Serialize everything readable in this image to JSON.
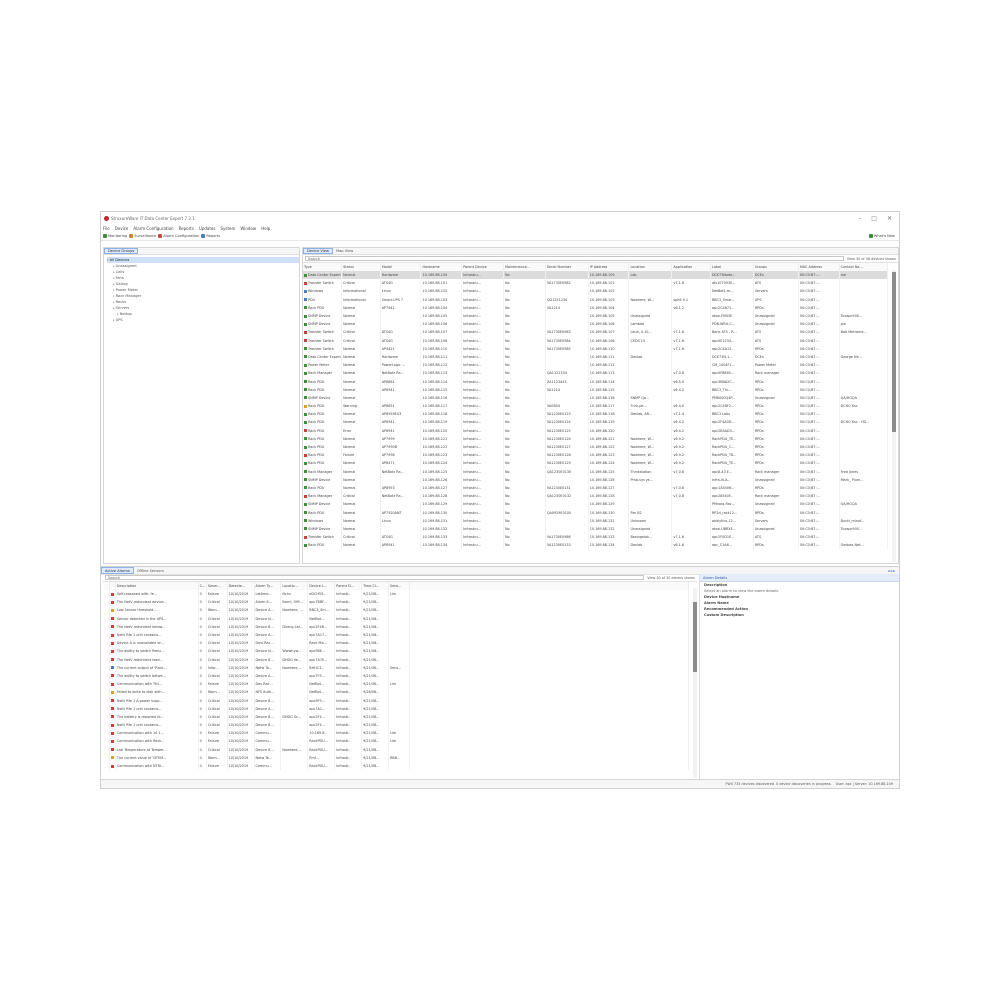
{
  "window": {
    "title": "StruxureWare IT Data Center Expert 7.3.1",
    "minimize": "–",
    "maximize": "□",
    "close": "✕"
  },
  "menu": [
    "File",
    "Device",
    "Alarm Configuration",
    "Reports",
    "Updates",
    "System",
    "Window",
    "Help"
  ],
  "toolbar": {
    "items": [
      {
        "label": "Monitoring",
        "color": "#3a8e3a"
      },
      {
        "label": "Surveillance",
        "color": "#c98a28"
      },
      {
        "label": "Alarm Configuration",
        "color": "#c44"
      },
      {
        "label": "Reports",
        "color": "#4a7cc0"
      }
    ],
    "right_label": "What's New"
  },
  "left_pane": {
    "tab": "Device Groups",
    "tree": [
      {
        "label": "All Devices",
        "level": 0,
        "selected": true
      },
      {
        "label": "Unassigned",
        "level": 1
      },
      {
        "label": "Cells",
        "level": 1
      },
      {
        "label": "Fans",
        "level": 1
      },
      {
        "label": "Galaxy",
        "level": 1
      },
      {
        "label": "Power Meter",
        "level": 1
      },
      {
        "label": "Rack Manager",
        "level": 1
      },
      {
        "label": "Racks",
        "level": 1
      },
      {
        "label": "Servers",
        "level": 1
      },
      {
        "label": "Nettop",
        "level": 2
      },
      {
        "label": "UPS",
        "level": 1
      }
    ]
  },
  "device_view": {
    "tabs": [
      "Device View",
      "Map View"
    ],
    "search_placeholder": "Search",
    "view_info": "View 30 of 36 devices shown",
    "columns": [
      "Type",
      "Status",
      "Model",
      "Hostname",
      "Parent Device",
      "Maintenance...",
      "Serial Number",
      "IP Address",
      "Location",
      "Application",
      "Label",
      "Groups",
      "MAC Address",
      "Contact Na..."
    ],
    "rows": [
      [
        "Data Center Expert",
        "Normal",
        "Hardware",
        "10.169.88.109",
        "Infrastru...",
        "No",
        "",
        "10.169.88.109",
        "Lab",
        "",
        "DCE73Node...",
        "DCEs",
        "00:C0:B7:...",
        "me"
      ],
      [
        "Transfer Switch",
        "Critical",
        "ATS4G",
        "10.169.88.101",
        "Infrastru...",
        "No",
        "5A1730E0982",
        "10.169.88.101",
        "",
        "v7.1.6",
        "ats1070930...",
        "ATS",
        "00:C0:B7:...",
        ""
      ],
      [
        "Windows",
        "Informational",
        "Linux",
        "10.169.88.102",
        "Infrastru...",
        "No",
        "",
        "10.169.88.102",
        "",
        "",
        "NetBot1.m...",
        "Servers",
        "00:C0:B7:...",
        ""
      ],
      [
        "PDU",
        "Informational",
        "Smart-UPS 7",
        "10.169.88.103",
        "Infrastru...",
        "No",
        "QD1251234",
        "10.169.88.103",
        "Nowhere, W...",
        "sph6.9.1",
        "BBC3_Smar...",
        "UPS",
        "00:C0:B7:...",
        ""
      ],
      [
        "Rack PDU",
        "Normal",
        "AP7941",
        "10.169.88.104",
        "Infrastru...",
        "No",
        "5A1214",
        "10.169.88.104",
        "",
        "v6.1.2",
        "apc2C4671...",
        "RPDs",
        "00:C0:B7:...",
        ""
      ],
      [
        "SNMP Device",
        "Normal",
        "",
        "10.169.88.105",
        "Infrastru...",
        "No",
        "",
        "10.169.88.105",
        "Unassigned",
        "",
        "atsw-FM05E",
        "Unassigned",
        "00:C0:B7:...",
        "Tuxapc900..."
      ],
      [
        "SNMP Device",
        "Normal",
        "",
        "10.169.88.106",
        "Infrastru...",
        "No",
        "",
        "10.169.88.106",
        "Lambda",
        "",
        "PDB-WRU-C...",
        "Unassigned",
        "00:C0:B7:...",
        "joe"
      ],
      [
        "Transfer Switch",
        "Critical",
        "ATS4G",
        "10.169.88.107",
        "Infrastru...",
        "No",
        "5A1730E0983",
        "10.169.88.107",
        "Laub, 0.10...",
        "v7.1.6",
        "Bank ATS - R...",
        "ATS",
        "00:C0:B7:...",
        "Bob Metrame..."
      ],
      [
        "Transfer Switch",
        "Critical",
        "ATS4G",
        "10.169.88.108",
        "Infrastru...",
        "No",
        "5A1730E0984",
        "10.169.88.108",
        "CEDS 15",
        "v7.1.6",
        "apc0E1234...",
        "ATS",
        "00:C0:B7:...",
        ""
      ],
      [
        "Transfer Switch",
        "Normal",
        "AP4421",
        "10.169.88.110",
        "Infrastru...",
        "No",
        "5A1730E0985",
        "10.169.88.110",
        "",
        "v7.1.6",
        "apc2C4A12...",
        "RPDs",
        "00:C0:B7:...",
        ""
      ],
      [
        "Data Center Expert",
        "Normal",
        "Hardware",
        "10.169.88.111",
        "Infrastru...",
        "No",
        "",
        "10.169.88.111",
        "Devlab",
        "",
        "DCE73N-1...",
        "DCEs",
        "00:C0:B7:...",
        "George Ne..."
      ],
      [
        "Power Meter",
        "Normal",
        "PowerLogic ...",
        "10.169.88.112",
        "Infrastru...",
        "No",
        "",
        "10.169.88.112",
        "",
        "",
        "CM_1004F1...",
        "Power Meter",
        "00:C0:B7:...",
        ""
      ],
      [
        "Rack Manager",
        "Normal",
        "NetBotz Ra...",
        "10.169.88.113",
        "Infrastru...",
        "No",
        "QA1122334",
        "10.169.88.113",
        "",
        "v7.0.8",
        "apc0F8880...",
        "Rack manager",
        "00:C0:B7:...",
        ""
      ],
      [
        "Rack PDU",
        "Normal",
        "AP8861",
        "10.169.88.114",
        "Infrastru...",
        "No",
        "ZA1123443",
        "10.169.88.114",
        "",
        "v6.5.0",
        "apc3BBA2C...",
        "RPDs",
        "00:C0:B7:...",
        ""
      ],
      [
        "Rack PDU",
        "Normal",
        "AP8941",
        "10.169.88.115",
        "Infrastru...",
        "No",
        "5A1214",
        "10.169.88.115",
        "",
        "v6.4.2",
        "BBC3_Thi-...",
        "RPDs",
        "00:C0:B7:...",
        ""
      ],
      [
        "SNMP Device",
        "Normal",
        "",
        "10.169.88.116",
        "Infrastru...",
        "No",
        "",
        "10.169.88.116",
        "SNMP Qa...",
        "",
        "PM8000Q4P...",
        "Unassigned",
        "00:C0:B7:...",
        "QA/HGQA"
      ],
      [
        "Rack PDU",
        "Warning",
        "AP8651",
        "10.169.88.117",
        "Infrastru...",
        "No",
        "5A0804",
        "10.169.88.117",
        "Tnrk-pe...",
        "v6.4.0",
        "apc2C48F2...",
        "RPDs",
        "00:C0:B7:...",
        "DCHG Ksc"
      ],
      [
        "Rack PDU",
        "Normal",
        "AP8959EU3",
        "10.169.88.118",
        "Infrastru...",
        "No",
        "5A1230E0123",
        "10.169.88.118",
        "Devlab, AR...",
        "v7.1.4",
        "BBC3 Labs",
        "RPDs",
        "00:C0:B7:...",
        ""
      ],
      [
        "Rack PDU",
        "Normal",
        "AP8941",
        "10.169.88.119",
        "Infrastru...",
        "No",
        "5A1230E0124",
        "10.169.88.119",
        "",
        "v6.4.2",
        "apc2F4A0D...",
        "RPDs",
        "00:C0:B7:...",
        "DCHG Ksc - HG..."
      ],
      [
        "Rack PDU",
        "Error",
        "AP8941",
        "10.169.88.120",
        "Infrastru...",
        "No",
        "5A1230E0125",
        "10.169.88.120",
        "",
        "v6.4.2",
        "apc2B3AD3...",
        "RPDs",
        "00:C0:B7:...",
        ""
      ],
      [
        "Rack PDU",
        "Normal",
        "AP7999",
        "10.169.88.121",
        "Infrastru...",
        "No",
        "5A1230E0126",
        "10.169.88.121",
        "Nowhere, W...",
        "v6.9.2",
        "RackPDU_TE...",
        "RPDs",
        "00:C0:B7:...",
        ""
      ],
      [
        "Rack PDU",
        "Normal",
        "AP7990B",
        "10.169.88.122",
        "Infrastru...",
        "No",
        "5A1230E0127",
        "10.169.88.122",
        "Nowhere, W...",
        "v6.9.2",
        "RackPDU_C...",
        "RPDs",
        "00:C0:B7:...",
        ""
      ],
      [
        "Rack PDU",
        "Failure",
        "AP7998",
        "10.169.88.123",
        "Infrastru...",
        "No",
        "5A1230E0128",
        "10.169.88.123",
        "Nowhere, W...",
        "v6.9.2",
        "RackPDU_T8...",
        "RPDs",
        "00:C0:B7:...",
        ""
      ],
      [
        "Rack PDU",
        "Normal",
        "AP8471",
        "10.169.88.124",
        "Infrastru...",
        "No",
        "5A1230E0129",
        "10.169.88.124",
        "Nowhere, W...",
        "v6.9.2",
        "RackPDU_TE...",
        "RPDs",
        "00:C0:B7:...",
        ""
      ],
      [
        "Rack Manager",
        "Normal",
        "NetBotz Ra...",
        "10.169.88.125",
        "Infrastru...",
        "No",
        "QA1230E0130",
        "10.169.88.125",
        "Thinkstation",
        "v7.0.8",
        "apc8-43 E...",
        "Rack manager",
        "00:C0:B7:...",
        "Fred Jones"
      ],
      [
        "SNMP Device",
        "Normal",
        "",
        "10.169.88.126",
        "Infrastru...",
        "No",
        "",
        "10.169.88.126",
        "Pmb-sys ys...",
        "",
        "Infra-VLA...",
        "Unassigned",
        "00:C0:B7:...",
        "Mark_ Plum..."
      ],
      [
        "Rack PDU",
        "Normal",
        "AP8953",
        "10.169.88.127",
        "Infrastru...",
        "No",
        "5A1230E0131",
        "10.169.88.127",
        "",
        "v7.0.8",
        "apc1A5406...",
        "RPDs",
        "00:C0:B7:...",
        ""
      ],
      [
        "Rack Manager",
        "Critical",
        "NetBotz Ra...",
        "10.169.88.128",
        "Infrastru...",
        "No",
        "QA1230E0132",
        "10.169.88.128",
        "",
        "v7.0.8",
        "apc28540F...",
        "Rack manager",
        "00:C0:B7:...",
        ""
      ],
      [
        "SNMP Device",
        "Normal",
        "",
        "10.169.88.129",
        "Infrastru...",
        "No",
        "",
        "10.169.88.129",
        "",
        "",
        "PMnolq-Rac...",
        "Unassigned",
        "00:C0:B7:...",
        "QA/HGQA"
      ],
      [
        "Rack PDU",
        "Normal",
        "AP7920ANT",
        "10.169.88.130",
        "Infrastru...",
        "No",
        "QA0929E0100",
        "10.169.88.130",
        "Rm B2",
        "",
        "RP2d_rack12...",
        "RPDs",
        "00:C0:B7:...",
        ""
      ],
      [
        "Windows",
        "Normal",
        "Linux",
        "10.169.88.131",
        "Infrastru...",
        "No",
        "",
        "10.169.88.131",
        "Unknown",
        "",
        "analytics-12...",
        "Servers",
        "00:C0:B7:...",
        "Bucki_minof..."
      ],
      [
        "SNMP Device",
        "Normal",
        "",
        "10.169.88.132",
        "Infrastru...",
        "No",
        "",
        "10.169.88.132",
        "Unassigned",
        "",
        "atsw-UBRXE...",
        "Unassigned",
        "00:C0:B7:...",
        "Tuxapc900..."
      ],
      [
        "Transfer Switch",
        "Critical",
        "ATS4G",
        "10.169.88.133",
        "Infrastru...",
        "No",
        "5A1730E0986",
        "10.169.88.133",
        "Basingstok...",
        "v7.1.6",
        "apc2F0D1E...",
        "ATS",
        "00:C0:B7:...",
        ""
      ],
      [
        "Rack PDU",
        "Normal",
        "AP8941",
        "10.169.88.134",
        "Infrastru...",
        "No",
        "5A1230E0133",
        "10.169.88.134",
        "Devlab",
        "v6.1.6",
        "apc_C1A6...",
        "RPDs",
        "00:C0:B7:...",
        "Geobas Net..."
      ]
    ]
  },
  "bottom_tabs": [
    "Active Alarms",
    "Offline Sensors"
  ],
  "alarms": {
    "search_placeholder": "Search",
    "view_info": "View 30 of 30 alarms shown",
    "columns": [
      "",
      "",
      "Description",
      "C...",
      "Sever...",
      "Detecte...",
      "Alarm Ty...",
      "Locatio...",
      "Device L...",
      "Parent D...",
      "Time Cl...",
      "Sens..."
    ],
    "rows": [
      [
        "Self-reasoned with: fe...",
        "0",
        "Failure",
        "10/10/2019",
        "Lettime...",
        "Nchz",
        "eDCH55...",
        "Infrastr...",
        "9/21/08...",
        "Lim"
      ],
      [
        "The NetV redundant device...",
        "0",
        "Critical",
        "10/10/2019",
        "Alarm 6...",
        "Barrii, Offi...",
        "apc7BBF...",
        "Infrastr...",
        "9/21/08...",
        ""
      ],
      [
        "Low Sensor threshold...",
        "0",
        "Warn...",
        "10/10/2019",
        "Device A...",
        "Nowhere, ...",
        "BBC3_Sm...",
        "Infrastr...",
        "9/21/08...",
        ""
      ],
      [
        "Sensor detected in the UPS...",
        "0",
        "Critical",
        "10/10/2019",
        "Device N...",
        "",
        "NetBot...",
        "Infrastr...",
        "9/21/08...",
        ""
      ],
      [
        "The NetV redundant below...",
        "0",
        "Critical",
        "10/10/2019",
        "Device B...",
        "Dhang Lar...",
        "apc2F4B...",
        "Infrastr...",
        "9/21/08...",
        ""
      ],
      [
        "NetV Rfe 1 unit contains...",
        "0",
        "Critical",
        "10/10/2019",
        "Device A...",
        "",
        "apc7A17...",
        "Infrastr...",
        "9/21/08...",
        ""
      ],
      [
        "Device A is unavailable or...",
        "0",
        "Critical",
        "10/10/2019",
        "Devi Rac...",
        "",
        "Rack Ma...",
        "Infrastr...",
        "9/21/08...",
        ""
      ],
      [
        "The ability to switch Redu...",
        "0",
        "Critical",
        "10/10/2019",
        "Device N...",
        "Wwwhyw...",
        "apc9BE...",
        "Infrastr...",
        "9/21/08...",
        ""
      ],
      [
        "The NetV redundant lead...",
        "0",
        "Critical",
        "10/10/2019",
        "Device B...",
        "DHDG Ve...",
        "apc7A7E...",
        "Infrastr...",
        "9/21/08...",
        ""
      ],
      [
        "The current output of ‘Rack...",
        "0",
        "Infor...",
        "10/10/2019",
        "Netw To...",
        "Nowhere,...",
        "BHHC3...",
        "Infrastr...",
        "9/21/08...",
        "Sens..."
      ],
      [
        "The ability to switch betwe...",
        "0",
        "Critical",
        "10/10/2019",
        "Device A...",
        "",
        "apc7F5...",
        "Infrastr...",
        "9/21/08...",
        ""
      ],
      [
        "Communication with Tfcl...",
        "0",
        "Failure",
        "10/10/2019",
        "Dev Rac...",
        "",
        "NetBot...",
        "Infrastr...",
        "9/21/08...",
        "Lim"
      ],
      [
        "Failed to write to disk with...",
        "0",
        "Warn...",
        "10/10/2019",
        "NFS Auth...",
        "",
        "NetBot...",
        "Infrastr...",
        "9/26/08...",
        ""
      ],
      [
        "NetV Rfe 1 A power supp...",
        "0",
        "Critical",
        "10/10/2019",
        "Device B...",
        "",
        "apc9F9...",
        "Infrastr...",
        "9/21/08...",
        ""
      ],
      [
        "NetV Rfe 1 unit contains...",
        "0",
        "Critical",
        "10/10/2019",
        "Device A...",
        "",
        "apc7A1...",
        "Infrastr...",
        "9/21/08...",
        ""
      ],
      [
        "The battery is reported fo...",
        "0",
        "Critical",
        "10/10/2019",
        "Device B...",
        "DHDG Sc...",
        "apc2F4...",
        "Infrastr...",
        "9/21/08...",
        ""
      ],
      [
        "NetV Rfe 1 unit contains...",
        "0",
        "Critical",
        "10/10/2019",
        "Device B...",
        "",
        "apc2F4...",
        "Infrastr...",
        "9/21/08...",
        ""
      ],
      [
        "Communication with 10.1...",
        "0",
        "Failure",
        "10/10/2019",
        "Commu...",
        "",
        "10.169.8...",
        "Infrastr...",
        "9/21/08...",
        "Lim"
      ],
      [
        "Communication with Rack...",
        "0",
        "Failure",
        "10/10/2019",
        "Commu...",
        "",
        "RackPDU...",
        "Infrastr...",
        "9/21/08...",
        "Lim"
      ],
      [
        "Lab Temperature at Temper...",
        "0",
        "Critical",
        "10/10/2019",
        "Device B...",
        "Nowhere,...",
        "RackPDU...",
        "Infrastr...",
        "9/21/08...",
        ""
      ],
      [
        "The current value of ‘NTEM...",
        "0",
        "Warn...",
        "10/10/2019",
        "Netw Te...",
        "",
        "Pmf...",
        "Infrastr...",
        "9/21/08...",
        "RBB..."
      ],
      [
        "Communication with NTRI...",
        "0",
        "Failure",
        "10/10/2019",
        "Commu...",
        "",
        "RackPDU...",
        "Infrastr...",
        "9/21/08...",
        ""
      ]
    ]
  },
  "details": {
    "header": "Alarm Details",
    "lines": [
      {
        "text": "Description",
        "style": "b"
      },
      {
        "text": "Select an alarm to view the alarm details.",
        "style": "t"
      },
      {
        "text": "Device Hostname",
        "style": "b"
      },
      {
        "text": "Alarm Name",
        "style": "b"
      },
      {
        "text": "Recommended Action",
        "style": "b"
      },
      {
        "text": "Custom Description",
        "style": "b"
      }
    ]
  },
  "status": {
    "left": "FW4 735 devices discovered. 0 device discoveries in progress.",
    "right": "User: apc | Server: 10.169.88.109"
  },
  "colors": {
    "critical": "#d23c3c",
    "warning": "#e0a020",
    "normal": "#3c8f3c",
    "selection": "#cfe0f6"
  }
}
